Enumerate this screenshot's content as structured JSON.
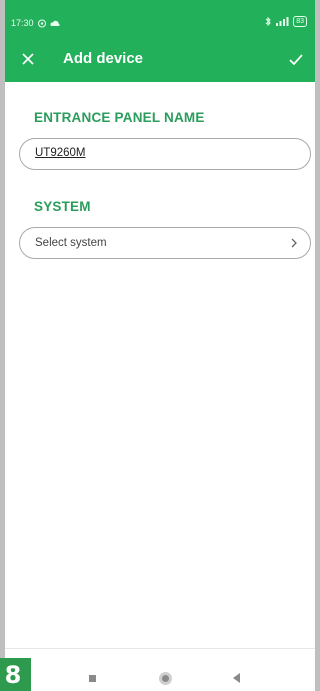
{
  "status_bar": {
    "time": "17:30",
    "battery": "83"
  },
  "app_bar": {
    "title": "Add device"
  },
  "form": {
    "panel_name_label": "ENTRANCE PANEL NAME",
    "panel_name_value": "UT9260M",
    "system_label": "SYSTEM",
    "system_placeholder": "Select system"
  },
  "step_badge": "8",
  "colors": {
    "header_green": "#22b05a",
    "label_green": "#2a9d5c",
    "badge_green": "#2e9a4e"
  }
}
